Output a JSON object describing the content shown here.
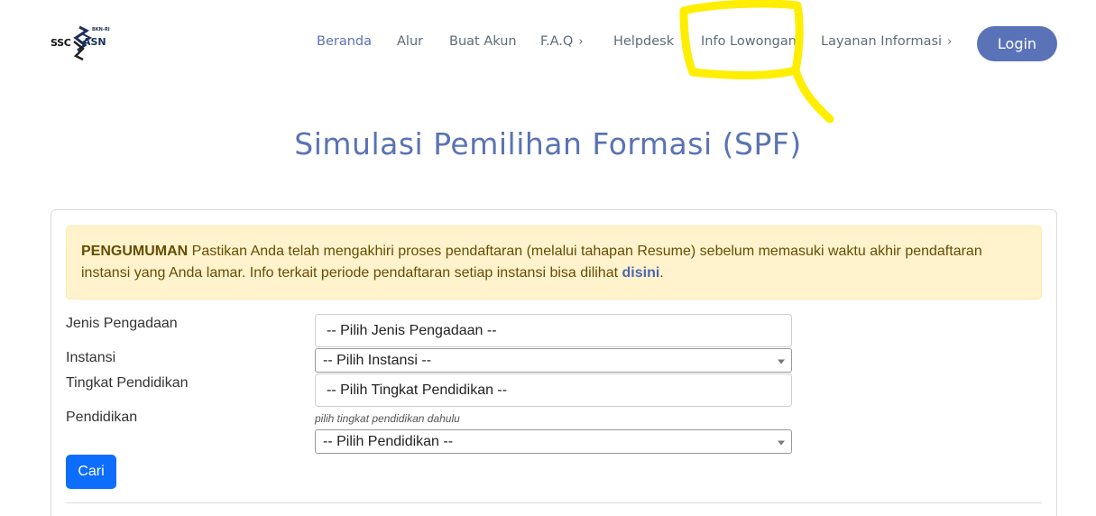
{
  "logo": {
    "ssc": "SSC",
    "asn": "ASN",
    "bkn": "BKN-RI"
  },
  "nav": {
    "items": [
      {
        "label": "Beranda"
      },
      {
        "label": "Alur"
      },
      {
        "label": "Buat Akun"
      },
      {
        "label": "F.A.Q"
      },
      {
        "label": "Helpdesk"
      },
      {
        "label": "Info Lowongan"
      },
      {
        "label": "Layanan Informasi"
      }
    ],
    "login": "Login"
  },
  "page": {
    "title": "Simulasi Pemilihan Formasi (SPF)"
  },
  "announcement": {
    "heading": "PENGUMUMAN",
    "text": "Pastikan Anda telah mengakhiri proses pendaftaran (melalui tahapan Resume) sebelum memasuki waktu akhir pendaftaran instansi yang Anda lamar. Info terkait periode pendaftaran setiap instansi bisa dilihat",
    "link": "disini",
    "period": "."
  },
  "form": {
    "jenis_label": "Jenis Pengadaan",
    "jenis_value": "-- Pilih Jenis Pengadaan --",
    "instansi_label": "Instansi",
    "instansi_value": "-- Pilih Instansi --",
    "tingkat_label": "Tingkat Pendidikan",
    "tingkat_value": "-- Pilih Tingkat Pendidikan --",
    "pendidikan_label": "Pendidikan",
    "pendidikan_hint": "pilih tingkat pendidikan dahulu",
    "pendidikan_value": "-- Pilih Pendidikan --",
    "search_button": "Cari"
  },
  "colors": {
    "accent": "#5a73b4",
    "primary_button": "#0d6efd",
    "alert_bg": "#fff3cd",
    "highlight": "#fff200"
  }
}
